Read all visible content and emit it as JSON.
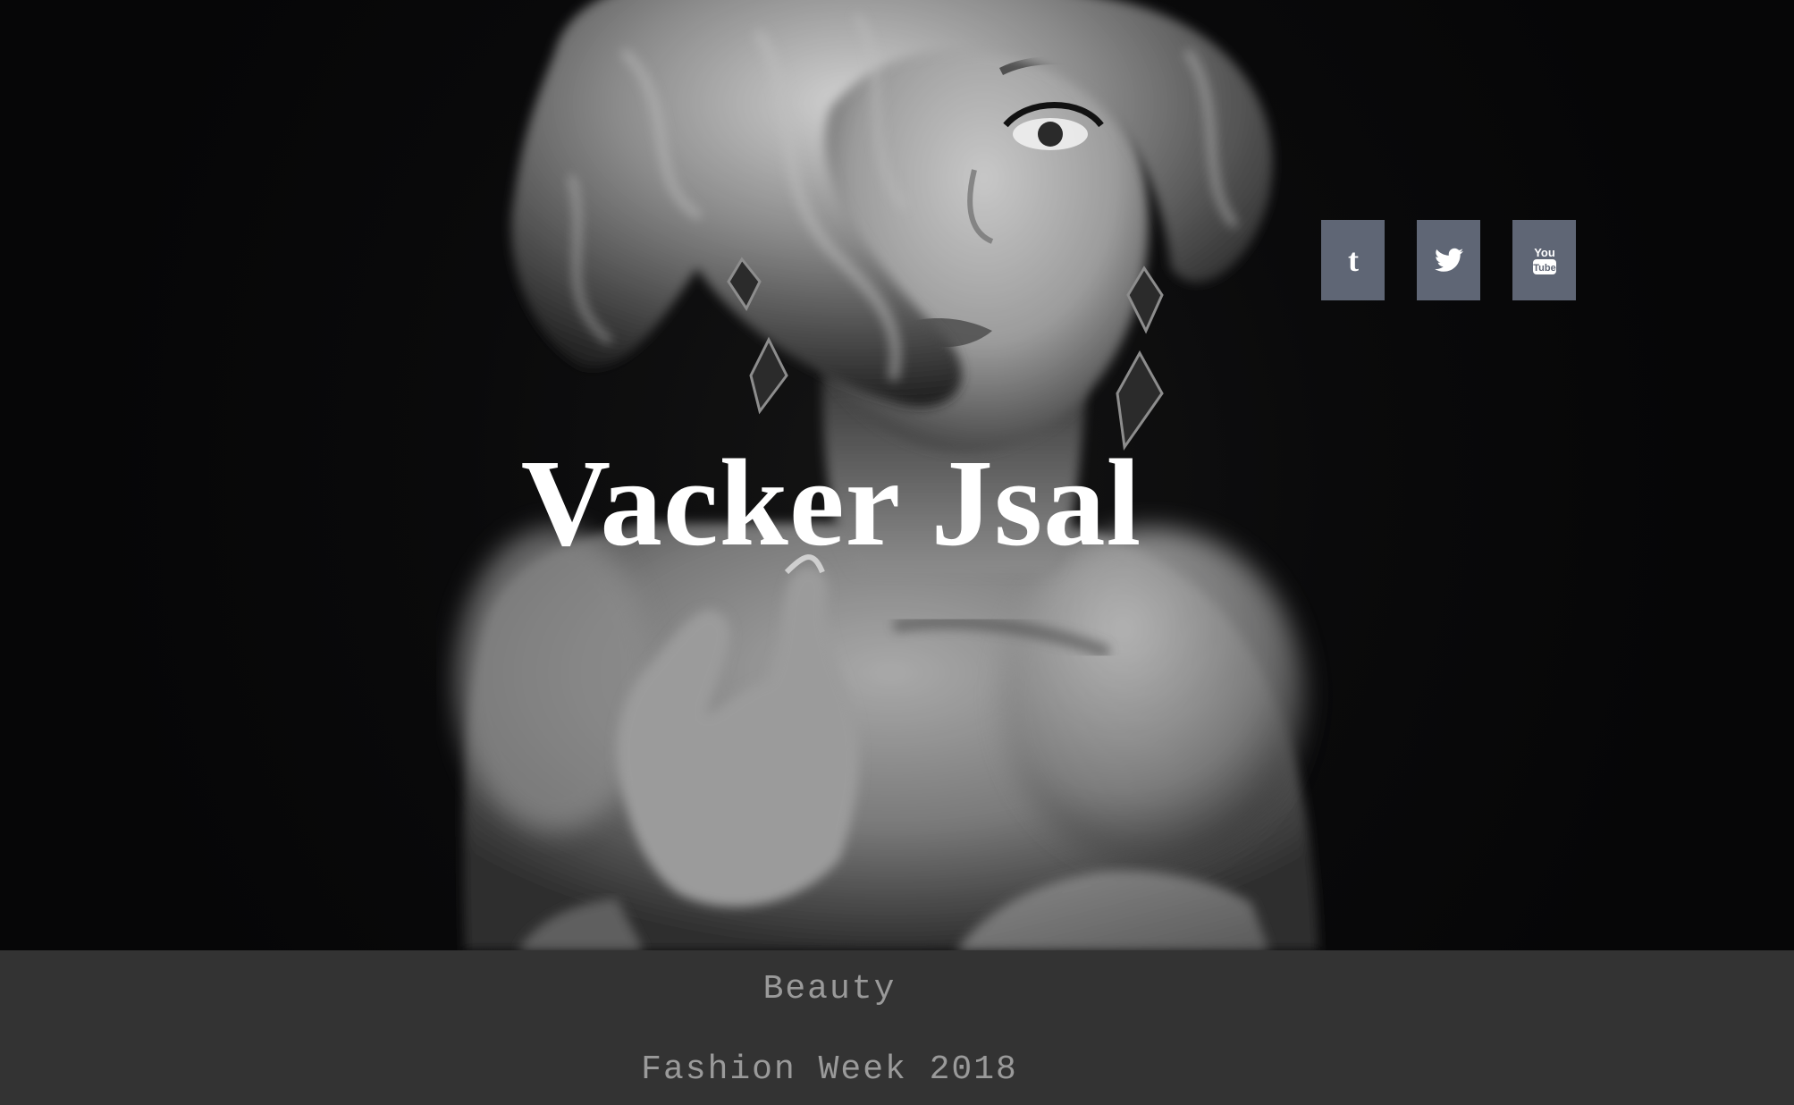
{
  "hero": {
    "title": "Vacker Jsal",
    "image_alt": "Black and white portrait of a woman with curly hair and drop earrings"
  },
  "social": {
    "items": [
      {
        "name": "tumblr",
        "glyph": "t",
        "icon": "tumblr-icon"
      },
      {
        "name": "twitter",
        "icon": "twitter-bird-icon"
      },
      {
        "name": "youtube",
        "glyph_top": "You",
        "glyph_bottom": "Tube",
        "icon": "youtube-icon"
      }
    ],
    "button_color": "#5f6675"
  },
  "band": {
    "line1": "Beauty",
    "line2": "Fashion Week 2018",
    "background": "#333333",
    "text_color": "#9a9a9a"
  }
}
